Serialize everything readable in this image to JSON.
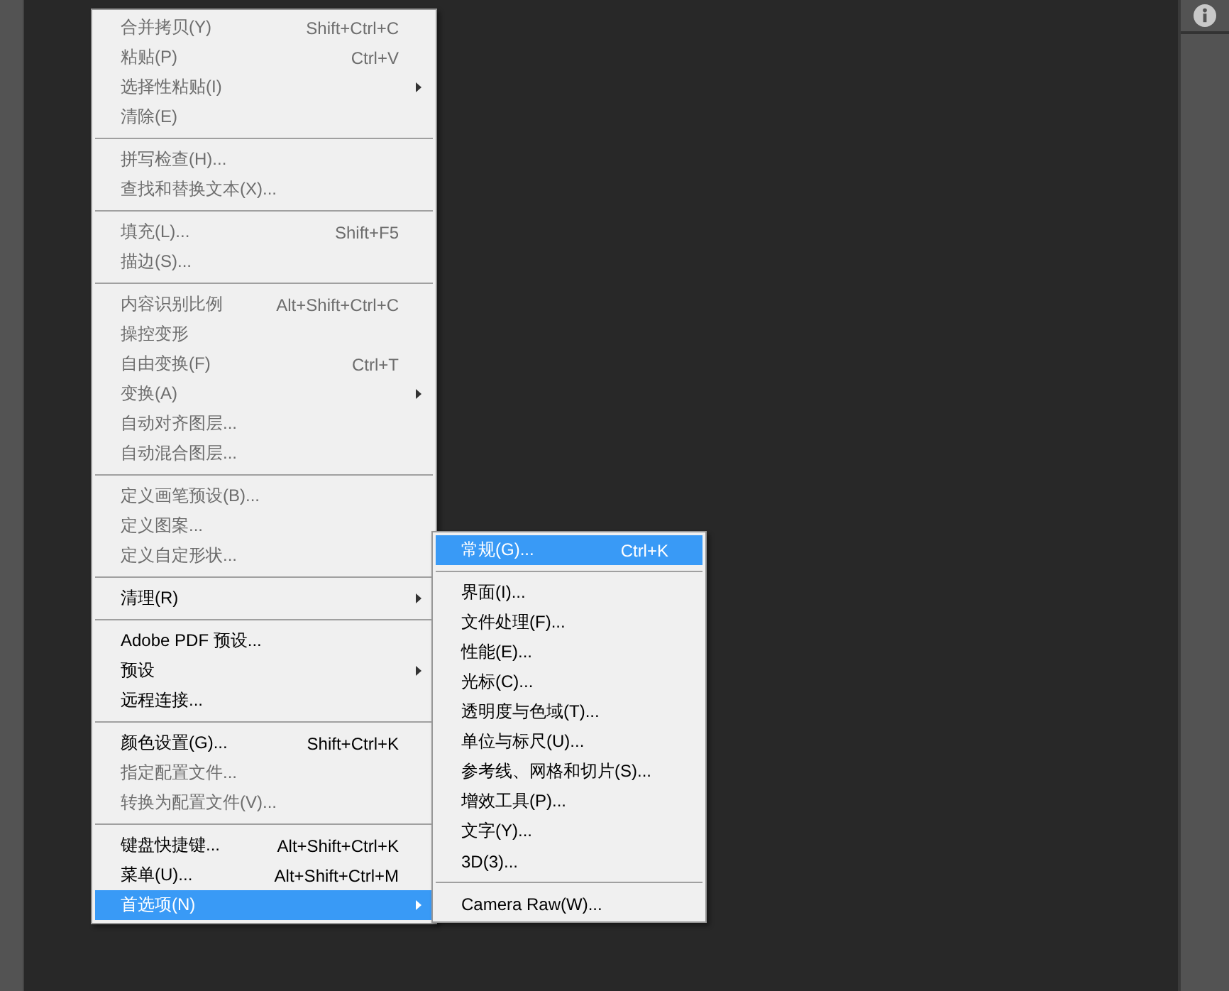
{
  "menu": {
    "groups": [
      {
        "items": [
          {
            "label": "合并拷贝(Y)",
            "shortcut": "Shift+Ctrl+C",
            "disabled": true,
            "has_submenu": false,
            "selected": false
          },
          {
            "label": "粘贴(P)",
            "shortcut": "Ctrl+V",
            "disabled": true,
            "has_submenu": false,
            "selected": false
          },
          {
            "label": "选择性粘贴(I)",
            "disabled": true,
            "has_submenu": true,
            "selected": false
          },
          {
            "label": "清除(E)",
            "disabled": true,
            "has_submenu": false,
            "selected": false
          }
        ]
      },
      {
        "items": [
          {
            "label": "拼写检查(H)...",
            "disabled": true,
            "has_submenu": false,
            "selected": false
          },
          {
            "label": "查找和替换文本(X)...",
            "disabled": true,
            "has_submenu": false,
            "selected": false
          }
        ]
      },
      {
        "items": [
          {
            "label": "填充(L)...",
            "shortcut": "Shift+F5",
            "disabled": true,
            "has_submenu": false,
            "selected": false
          },
          {
            "label": "描边(S)...",
            "disabled": true,
            "has_submenu": false,
            "selected": false
          }
        ]
      },
      {
        "items": [
          {
            "label": "内容识别比例",
            "shortcut": "Alt+Shift+Ctrl+C",
            "disabled": true,
            "has_submenu": false,
            "selected": false
          },
          {
            "label": "操控变形",
            "disabled": true,
            "has_submenu": false,
            "selected": false
          },
          {
            "label": "自由变换(F)",
            "shortcut": "Ctrl+T",
            "disabled": true,
            "has_submenu": false,
            "selected": false
          },
          {
            "label": "变换(A)",
            "disabled": true,
            "has_submenu": true,
            "selected": false
          },
          {
            "label": "自动对齐图层...",
            "disabled": true,
            "has_submenu": false,
            "selected": false
          },
          {
            "label": "自动混合图层...",
            "disabled": true,
            "has_submenu": false,
            "selected": false
          }
        ]
      },
      {
        "items": [
          {
            "label": "定义画笔预设(B)...",
            "disabled": true,
            "has_submenu": false,
            "selected": false
          },
          {
            "label": "定义图案...",
            "disabled": true,
            "has_submenu": false,
            "selected": false
          },
          {
            "label": "定义自定形状...",
            "disabled": true,
            "has_submenu": false,
            "selected": false
          }
        ]
      },
      {
        "items": [
          {
            "label": "清理(R)",
            "disabled": false,
            "has_submenu": true,
            "selected": false
          }
        ]
      },
      {
        "items": [
          {
            "label": "Adobe PDF 预设...",
            "disabled": false,
            "has_submenu": false,
            "selected": false
          },
          {
            "label": "预设",
            "disabled": false,
            "has_submenu": true,
            "selected": false
          },
          {
            "label": "远程连接...",
            "disabled": false,
            "has_submenu": false,
            "selected": false
          }
        ]
      },
      {
        "items": [
          {
            "label": "颜色设置(G)...",
            "shortcut": "Shift+Ctrl+K",
            "disabled": false,
            "has_submenu": false,
            "selected": false
          },
          {
            "label": "指定配置文件...",
            "disabled": true,
            "has_submenu": false,
            "selected": false
          },
          {
            "label": "转换为配置文件(V)...",
            "disabled": true,
            "has_submenu": false,
            "selected": false
          }
        ]
      },
      {
        "items": [
          {
            "label": "键盘快捷键...",
            "shortcut": "Alt+Shift+Ctrl+K",
            "disabled": false,
            "has_submenu": false,
            "selected": false
          },
          {
            "label": "菜单(U)...",
            "shortcut": "Alt+Shift+Ctrl+M",
            "disabled": false,
            "has_submenu": false,
            "selected": false
          },
          {
            "label": "首选项(N)",
            "disabled": false,
            "has_submenu": true,
            "selected": true
          }
        ]
      }
    ]
  },
  "submenu": {
    "groups": [
      {
        "items": [
          {
            "label": "常规(G)...",
            "shortcut": "Ctrl+K",
            "disabled": false,
            "has_submenu": false,
            "selected": true
          }
        ]
      },
      {
        "items": [
          {
            "label": "界面(I)...",
            "disabled": false,
            "has_submenu": false,
            "selected": false
          },
          {
            "label": "文件处理(F)...",
            "disabled": false,
            "has_submenu": false,
            "selected": false
          },
          {
            "label": "性能(E)...",
            "disabled": false,
            "has_submenu": false,
            "selected": false
          },
          {
            "label": "光标(C)...",
            "disabled": false,
            "has_submenu": false,
            "selected": false
          },
          {
            "label": "透明度与色域(T)...",
            "disabled": false,
            "has_submenu": false,
            "selected": false
          },
          {
            "label": "单位与标尺(U)...",
            "disabled": false,
            "has_submenu": false,
            "selected": false
          },
          {
            "label": "参考线、网格和切片(S)...",
            "disabled": false,
            "has_submenu": false,
            "selected": false
          },
          {
            "label": "增效工具(P)...",
            "disabled": false,
            "has_submenu": false,
            "selected": false
          },
          {
            "label": "文字(Y)...",
            "disabled": false,
            "has_submenu": false,
            "selected": false
          },
          {
            "label": "3D(3)...",
            "disabled": false,
            "has_submenu": false,
            "selected": false
          }
        ]
      },
      {
        "items": [
          {
            "label": "Camera Raw(W)...",
            "disabled": false,
            "has_submenu": false,
            "selected": false
          }
        ]
      }
    ]
  }
}
